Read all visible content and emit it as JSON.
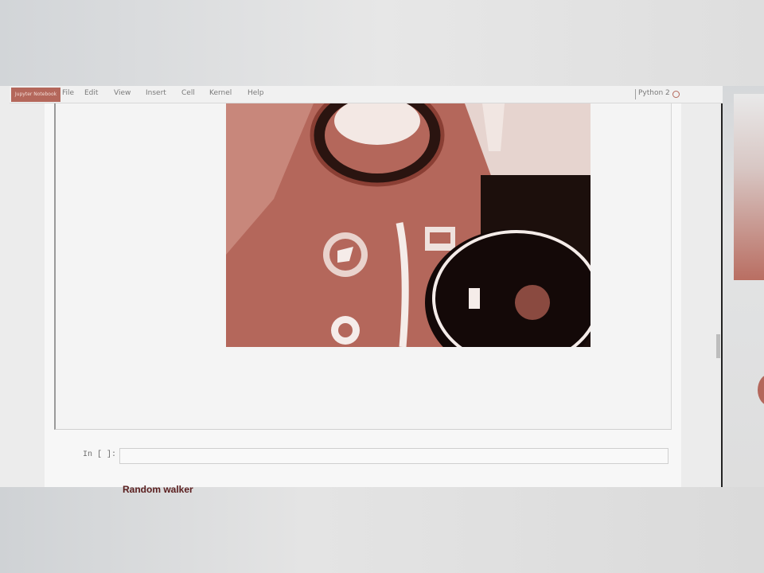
{
  "app": {
    "logo_text": "Jupyter Notebook"
  },
  "menu": {
    "items": [
      "File",
      "Edit",
      "View",
      "Insert",
      "Cell",
      "Kernel",
      "Help"
    ]
  },
  "kernel": {
    "name": "Python 2"
  },
  "output": {
    "image_subject": "astronaut photograph"
  },
  "cell": {
    "prompt": "In [ ]:"
  },
  "markdown": {
    "heading": "Random walker"
  },
  "colors": {
    "accent": "#b4675b",
    "heading": "#5a1e1e"
  }
}
